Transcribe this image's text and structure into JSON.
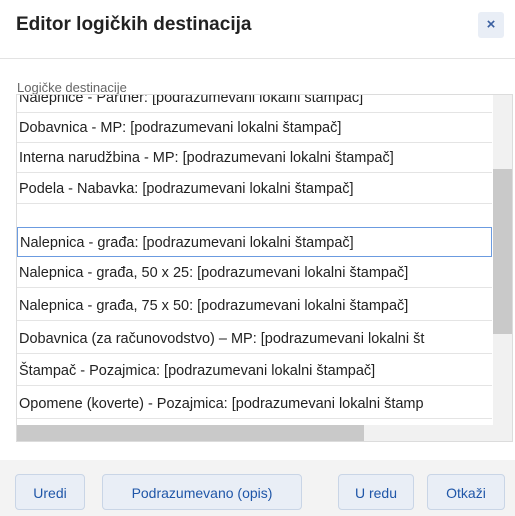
{
  "dialog": {
    "title": "Editor logičkih destinacija",
    "close_label": "×"
  },
  "list": {
    "label": "Logičke destinacije",
    "items": [
      "Nalepnice - Partner: [podrazumevani lokalni štampač]",
      "Dobavnica - MP: [podrazumevani lokalni štampač]",
      "Interna narudžbina - MP: [podrazumevani lokalni štampač]",
      "Podela - Nabavka: [podrazumevani lokalni štampač]",
      "Nalepnica - građa: [podrazumevani lokalni štampač]",
      "Nalepnica - građa, 50 x 25: [podrazumevani lokalni štampač]",
      "Nalepnica - građa, 75 x 50: [podrazumevani lokalni štampač]",
      "Dobavnica (za računovodstvo) – MP: [podrazumevani lokalni št",
      "Štampač - Pozajmica: [podrazumevani lokalni štampač]",
      "Opomene (koverte) - Pozajmica: [podrazumevani lokalni štamp"
    ],
    "selected_index": 4
  },
  "buttons": {
    "edit": "Uredi",
    "default_desc": "Podrazumevano (opis)",
    "ok": "U redu",
    "cancel": "Otkaži"
  }
}
